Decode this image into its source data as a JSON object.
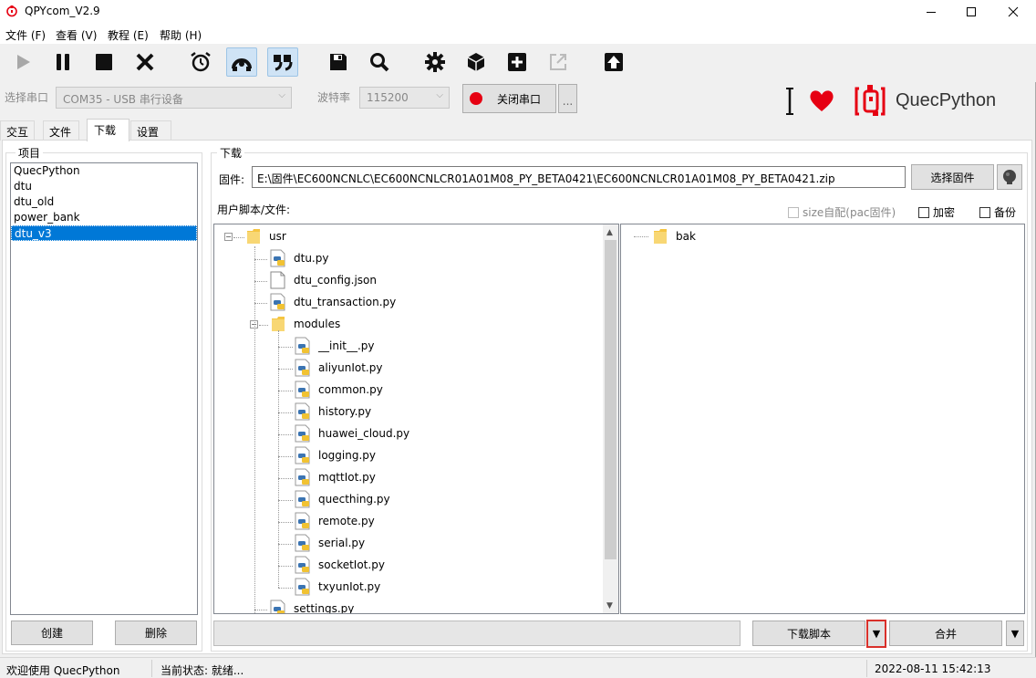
{
  "window": {
    "title": "QPYcom_V2.9"
  },
  "menu": {
    "items": [
      {
        "label": "文件 (F)"
      },
      {
        "label": "查看 (V)"
      },
      {
        "label": "教程 (E)"
      },
      {
        "label": "帮助 (H)"
      }
    ]
  },
  "toolbar": {
    "buttons": [
      {
        "icon": "play-icon",
        "enabled": false
      },
      {
        "icon": "pause-icon"
      },
      {
        "icon": "stop-icon"
      },
      {
        "icon": "close-x-icon"
      },
      {
        "icon": "alarm-clock-icon"
      },
      {
        "icon": "reconnect-icon",
        "active": true
      },
      {
        "icon": "quote-icon",
        "active": true
      },
      {
        "icon": "save-icon"
      },
      {
        "icon": "search-icon"
      },
      {
        "icon": "gear-icon"
      },
      {
        "icon": "package-box-icon"
      },
      {
        "icon": "plus-square-icon"
      },
      {
        "icon": "export-icon",
        "enabled": false
      },
      {
        "icon": "upload-arrow-icon"
      }
    ]
  },
  "port": {
    "port_label": "选择串口",
    "port_value": "COM35 - USB 串行设备",
    "baud_label": "波特率",
    "baud_value": "115200",
    "close_port_label": "关闭串口",
    "more_label": "..."
  },
  "brand": {
    "name": "QuecPython",
    "accent": "#e60012"
  },
  "tabs": [
    {
      "label": "交互"
    },
    {
      "label": "文件"
    },
    {
      "label": "下载",
      "active": true
    },
    {
      "label": "设置"
    }
  ],
  "projects": {
    "group_label": "项目",
    "items": [
      "QuecPython",
      "dtu",
      "dtu_old",
      "power_bank",
      "dtu_v3"
    ],
    "selected": "dtu_v3",
    "create_label": "创建",
    "delete_label": "删除"
  },
  "download": {
    "group_label": "下载",
    "firmware_label": "固件:",
    "firmware_path": "E:\\固件\\EC600NCNLC\\EC600NCNLCR01A01M08_PY_BETA0421\\EC600NCNLCR01A01M08_PY_BETA0421.zip",
    "select_firmware_label": "选择固件",
    "scripts_label": "用户脚本/文件:",
    "size_auto_label": "size自配(pac固件)",
    "encrypt_label": "加密",
    "backup_label": "备份",
    "download_script_label": "下载脚本",
    "dropdown_arrow": "▼",
    "merge_label": "合并"
  },
  "tree_left": {
    "root": "usr",
    "files": [
      "dtu.py",
      "dtu_config.json",
      "dtu_transaction.py"
    ],
    "folder": "modules",
    "module_files": [
      "__init__.py",
      "aliyunIot.py",
      "common.py",
      "history.py",
      "huawei_cloud.py",
      "logging.py",
      "mqttIot.py",
      "quecthing.py",
      "remote.py",
      "serial.py",
      "socketIot.py",
      "txyunIot.py"
    ],
    "after": [
      "settings.py"
    ]
  },
  "tree_right": {
    "root": "bak"
  },
  "status": {
    "welcome": "欢迎使用 QuecPython",
    "state": "当前状态: 就绪...",
    "datetime": "2022-08-11 15:42:13"
  }
}
